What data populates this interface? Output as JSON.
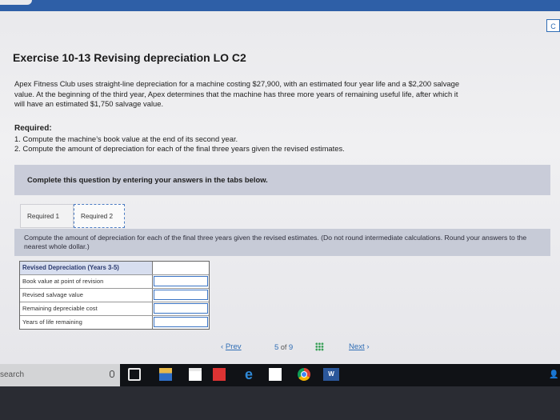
{
  "header": {
    "corner_button": "C"
  },
  "exercise": {
    "title": "Exercise 10-13 Revising depreciation LO C2",
    "paragraph_lines": [
      "Apex Fitness Club uses straight-line depreciation for a machine costing $27,900, with an estimated four year life and a $2,200 salvage",
      "value. At the beginning of the third year, Apex determines that the machine has three more years of remaining useful life, after which it",
      "will have an estimated $1,750 salvage value."
    ],
    "required_heading": "Required:",
    "required_items": [
      "1. Compute the machine’s book value at the end of its second year.",
      "2. Compute the amount of depreciation for each of the final three years given the revised estimates."
    ]
  },
  "banner": {
    "text": "Complete this question by entering your answers in the tabs below."
  },
  "tabs": [
    {
      "label": "Required 1",
      "active": false
    },
    {
      "label": "Required 2",
      "active": true
    }
  ],
  "instructions": {
    "text": "Compute the amount of depreciation for each of the final three years given the revised estimates. (Do not round intermediate calculations. Round your answers to the nearest whole dollar.)"
  },
  "table": {
    "header": "Revised Depreciation (Years 3-5)",
    "rows": [
      {
        "label": "Book value at point of revision",
        "value": ""
      },
      {
        "label": "Revised salvage value",
        "value": ""
      },
      {
        "label": "Remaining depreciable cost",
        "value": ""
      },
      {
        "label": "Years of life remaining",
        "value": ""
      }
    ]
  },
  "pagination": {
    "prev_label": "Prev",
    "next_label": "Next",
    "current": "5",
    "of": "of",
    "total": "9"
  },
  "taskbar": {
    "search_text": "search",
    "word_label": "W"
  },
  "colors": {
    "accent": "#2f6db5",
    "banner": "#c9ccd9",
    "table_header": "#d7deef",
    "input_border": "#3a74c5"
  }
}
